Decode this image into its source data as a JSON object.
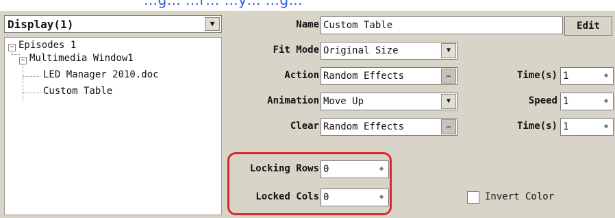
{
  "top_caption": "…g… …r… …y… …g…",
  "display_combo": {
    "value": "Display(1)"
  },
  "tree": {
    "root": "Episodes 1",
    "child": "Multimedia Window1",
    "leaf1": "LED Manager 2010.doc",
    "leaf2": "Custom Table"
  },
  "form": {
    "name_label": "Name",
    "name_value": "Custom Table",
    "edit_label": "Edit",
    "fit_mode_label": "Fit Mode",
    "fit_mode_value": "Original Size",
    "action_label": "Action",
    "action_value": "Random Effects",
    "action_time_label": "Time(s)",
    "action_time_value": "1",
    "animation_label": "Animation",
    "animation_value": "Move Up",
    "speed_label": "Speed",
    "speed_value": "1",
    "clear_label": "Clear",
    "clear_value": "Random Effects",
    "clear_time_label": "Time(s)",
    "clear_time_value": "1",
    "locking_rows_label": "Locking Rows",
    "locking_rows_value": "0",
    "locked_cols_label": "Locked Cols",
    "locked_cols_value": "0",
    "invert_color_label": "Invert Color",
    "invert_color_checked": false
  },
  "icons": {
    "dropdown": "chevron-down-icon",
    "spin": "spinner-icon",
    "more": "ellipsis-icon",
    "tree_toggle": "minus-box-icon"
  },
  "colors": {
    "highlight": "#d8262e",
    "panel": "#d9d4c8"
  }
}
